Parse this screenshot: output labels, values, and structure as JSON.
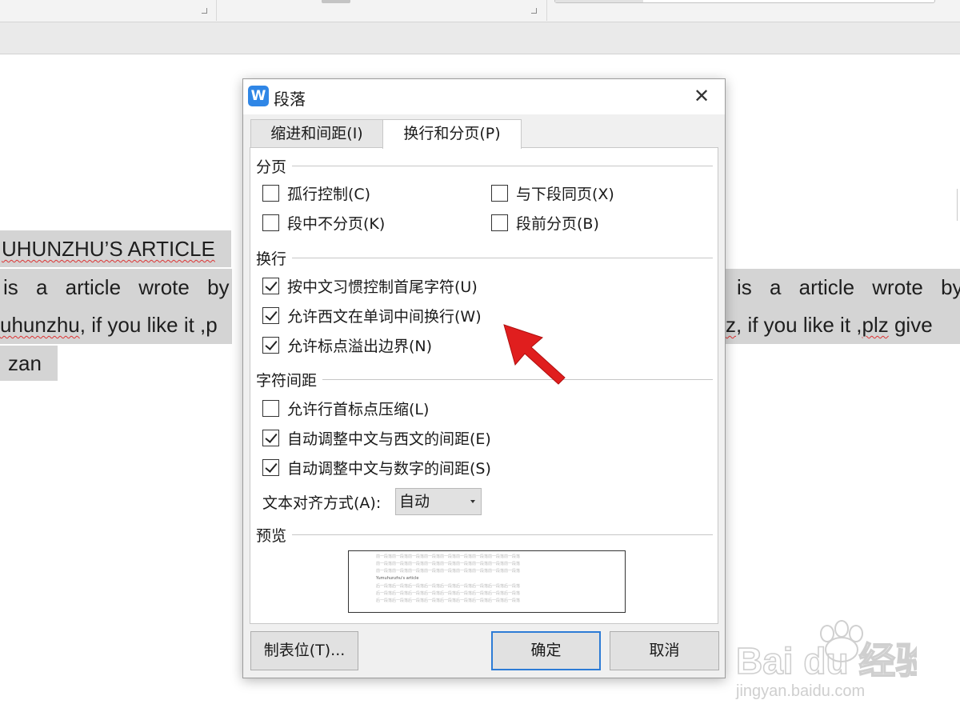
{
  "document": {
    "heading": "UHUNZHU’S ARTICLE",
    "left_line1": "is a article wrote by",
    "left_line2_word": "uhunzhu",
    "left_line2_rest": ", if you like it ,p",
    "left_line3": "zan",
    "right_line1": "is a article wrote by",
    "right_line2_word": "z",
    "right_line2_mid": ", if you like it ,",
    "right_line2_word2": "plz",
    "right_line2_rest": " give"
  },
  "dialog": {
    "app_icon": "W",
    "title": "段落",
    "close_label": "✕",
    "tabs": [
      {
        "label": "缩进和间距(I)",
        "active": false
      },
      {
        "label": "换行和分页(P)",
        "active": true
      }
    ],
    "sections": {
      "pagination": {
        "title": "分页",
        "options": [
          {
            "label": "孤行控制(C)",
            "checked": false
          },
          {
            "label": "与下段同页(X)",
            "checked": false
          },
          {
            "label": "段中不分页(K)",
            "checked": false
          },
          {
            "label": "段前分页(B)",
            "checked": false
          }
        ]
      },
      "line_break": {
        "title": "换行",
        "options": [
          {
            "label": "按中文习惯控制首尾字符(U)",
            "checked": true
          },
          {
            "label": "允许西文在单词中间换行(W)",
            "checked": true
          },
          {
            "label": "允许标点溢出边界(N)",
            "checked": true
          }
        ]
      },
      "char_spacing": {
        "title": "字符间距",
        "options": [
          {
            "label": "允许行首标点压缩(L)",
            "checked": false
          },
          {
            "label": "自动调整中文与西文的间距(E)",
            "checked": true
          },
          {
            "label": "自动调整中文与数字的间距(S)",
            "checked": true
          }
        ],
        "text_align_label": "文本对齐方式(A):",
        "text_align_value": "自动"
      },
      "preview": {
        "title": "预览",
        "prev_text": "前一段落前一段落前一段落前一段落前一段落前一段落前一段落前一段落前一段落",
        "main_text": "Yumuhunzhu's article",
        "next_text": "后一段落后一段落后一段落后一段落后一段落后一段落后一段落后一段落后一段落"
      }
    },
    "buttons": {
      "tabs": "制表位(T)...",
      "ok": "确定",
      "cancel": "取消"
    }
  },
  "watermark": {
    "brand": "Bai du 经验",
    "url": "jingyan.baidu.com"
  },
  "colors": {
    "accent": "#2d7bd6",
    "app_icon": "#2f86e6",
    "arrow": "#e01e1e",
    "selection": "#d4d4d4"
  }
}
